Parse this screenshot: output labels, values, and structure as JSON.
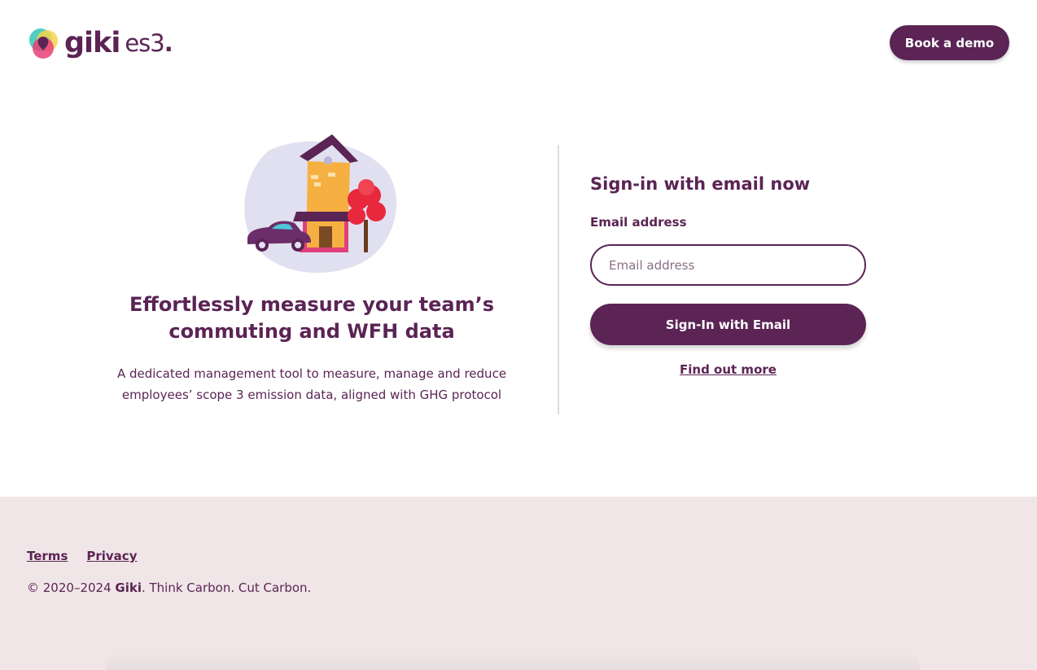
{
  "header": {
    "logo_word": "giki",
    "logo_sub": "es3",
    "logo_dot": ".",
    "demo_button": "Book a demo"
  },
  "hero": {
    "headline_line1": "Effortlessly measure your team’s",
    "headline_line2": "commuting and WFH data",
    "subtext_line1": "A dedicated management tool to measure, manage and reduce",
    "subtext_line2": "employees’ scope 3 emission data, aligned with GHG protocol"
  },
  "signin": {
    "title": "Sign-in with email now",
    "email_label": "Email address",
    "email_placeholder": "Email address",
    "email_value": "",
    "submit_label": "Sign-In with Email",
    "find_out_more": "Find out more"
  },
  "footer": {
    "links": [
      "Terms",
      "Privacy"
    ],
    "copyright_prefix": "© 2020–2024 ",
    "copyright_brand": "Giki",
    "copyright_suffix": ". Think Carbon. Cut Carbon."
  },
  "icons": {
    "logo": "giki-logo-icon",
    "illustration": "house-car-tree-illustration"
  },
  "colors": {
    "brand": "#5b2455",
    "footer_bg": "#f0e6e7",
    "blob": "#e1e0f0",
    "house": "#f6b042",
    "tree": "#e8283c"
  }
}
